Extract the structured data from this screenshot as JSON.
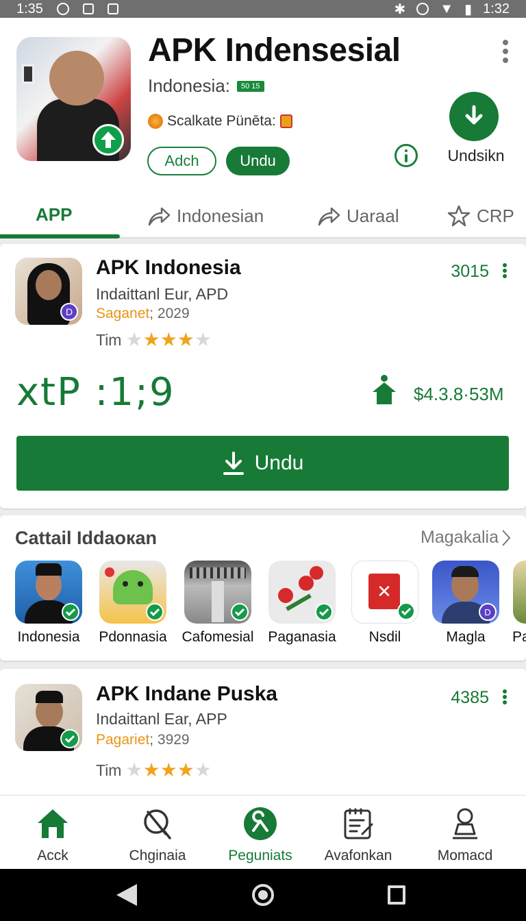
{
  "status_bar": {
    "time_left": "1:35",
    "time_right": "1:32"
  },
  "header": {
    "title": "APK Indensesial",
    "subtitle": "Indonesia:",
    "subtitle_badge": "50 15",
    "meta": "Scalkate Pünēta:",
    "btn_outline": "Adch",
    "btn_filled": "Undu",
    "download_label": "Undsikn"
  },
  "tabs": [
    {
      "label": "APP"
    },
    {
      "label": "Indonesian"
    },
    {
      "label": "Uaraal"
    },
    {
      "label": "CRP"
    }
  ],
  "card1": {
    "title": "APK Indonesia",
    "subtitle": "Indaittanl  Eur, APD",
    "orange": "Saganet",
    "year": "; 2029",
    "rating_label": "Tim",
    "rating": 3,
    "rating_max": 5,
    "count": "3015",
    "big_text": "xtP :1;9",
    "size": "$4.3.8·53M",
    "download_button": "Undu"
  },
  "section": {
    "title": "Cattail Iddaoкan",
    "more": "Magakalia",
    "apps": [
      {
        "label": "Indonesia"
      },
      {
        "label": "Pdonnasia"
      },
      {
        "label": "Cafomesial"
      },
      {
        "label": "Paganasia"
      },
      {
        "label": "Nsdil"
      },
      {
        "label": "Magla"
      },
      {
        "label": "Pa"
      }
    ]
  },
  "card3": {
    "title": "APK Indane Puska",
    "subtitle": "Indaittanl  Ear, APP",
    "orange": "Pagariet",
    "year": "; 3929",
    "rating_label": "Tim",
    "rating": 3,
    "rating_max": 5,
    "count": "4385"
  },
  "bottom_nav": [
    {
      "label": "Acck"
    },
    {
      "label": "Chginaia"
    },
    {
      "label": "Peguniats"
    },
    {
      "label": "Avafonkan"
    },
    {
      "label": "Momacd"
    }
  ],
  "colors": {
    "accent": "#177a36",
    "star": "#f2a21b",
    "orange_text": "#e89412"
  }
}
